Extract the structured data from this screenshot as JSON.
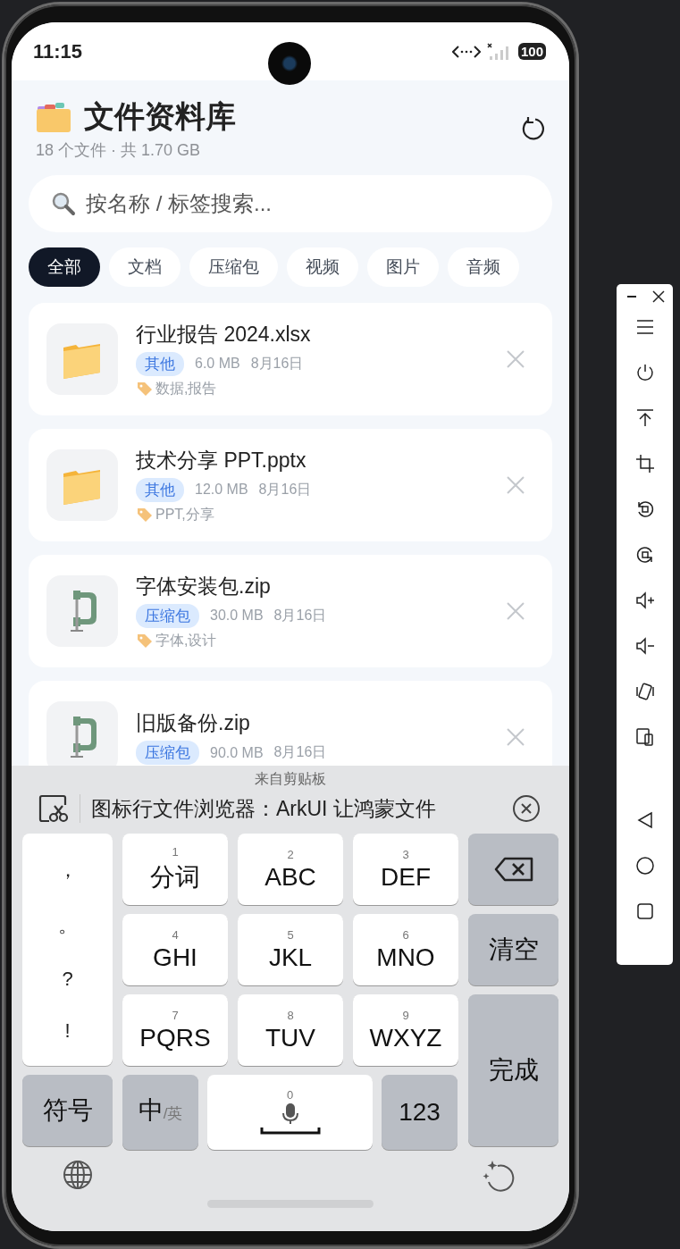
{
  "status_bar": {
    "time": "11:15",
    "battery": "100"
  },
  "header": {
    "title": "文件资料库",
    "subtitle": "18 个文件 · 共 1.70 GB"
  },
  "search": {
    "placeholder": "按名称 / 标签搜索..."
  },
  "filters": [
    {
      "label": "全部",
      "selected": true
    },
    {
      "label": "文档",
      "selected": false
    },
    {
      "label": "压缩包",
      "selected": false
    },
    {
      "label": "视频",
      "selected": false
    },
    {
      "label": "图片",
      "selected": false
    },
    {
      "label": "音频",
      "selected": false
    }
  ],
  "files": [
    {
      "name": "行业报告 2024.xlsx",
      "kind": "folder",
      "category": "其他",
      "size": "6.0 MB",
      "date": "8月16日",
      "tags": "数据,报告"
    },
    {
      "name": "技术分享 PPT.pptx",
      "kind": "folder",
      "category": "其他",
      "size": "12.0 MB",
      "date": "8月16日",
      "tags": "PPT,分享"
    },
    {
      "name": "字体安装包.zip",
      "kind": "clamp",
      "category": "压缩包",
      "size": "30.0 MB",
      "date": "8月16日",
      "tags": "字体,设计"
    },
    {
      "name": "旧版备份.zip",
      "kind": "clamp",
      "category": "压缩包",
      "size": "90.0 MB",
      "date": "8月16日"
    }
  ],
  "keyboard": {
    "clipboard_label": "来自剪贴板",
    "clipboard_text": "图标行文件浏览器：ArkUI 让鸿蒙文件",
    "punctuation": [
      "，",
      "。",
      "?",
      "!"
    ],
    "keys": [
      {
        "number": "1",
        "label": "分词"
      },
      {
        "number": "2",
        "label": "ABC"
      },
      {
        "number": "3",
        "label": "DEF"
      },
      {
        "number": "4",
        "label": "GHI"
      },
      {
        "number": "5",
        "label": "JKL"
      },
      {
        "number": "6",
        "label": "MNO"
      },
      {
        "number": "7",
        "label": "PQRS"
      },
      {
        "number": "8",
        "label": "TUV"
      },
      {
        "number": "9",
        "label": "WXYZ"
      }
    ],
    "clear": "清空",
    "done": "完成",
    "symbols": "符号",
    "lang_main": "中",
    "lang_alt": "/英",
    "space_number": "0",
    "numbers": "123"
  }
}
